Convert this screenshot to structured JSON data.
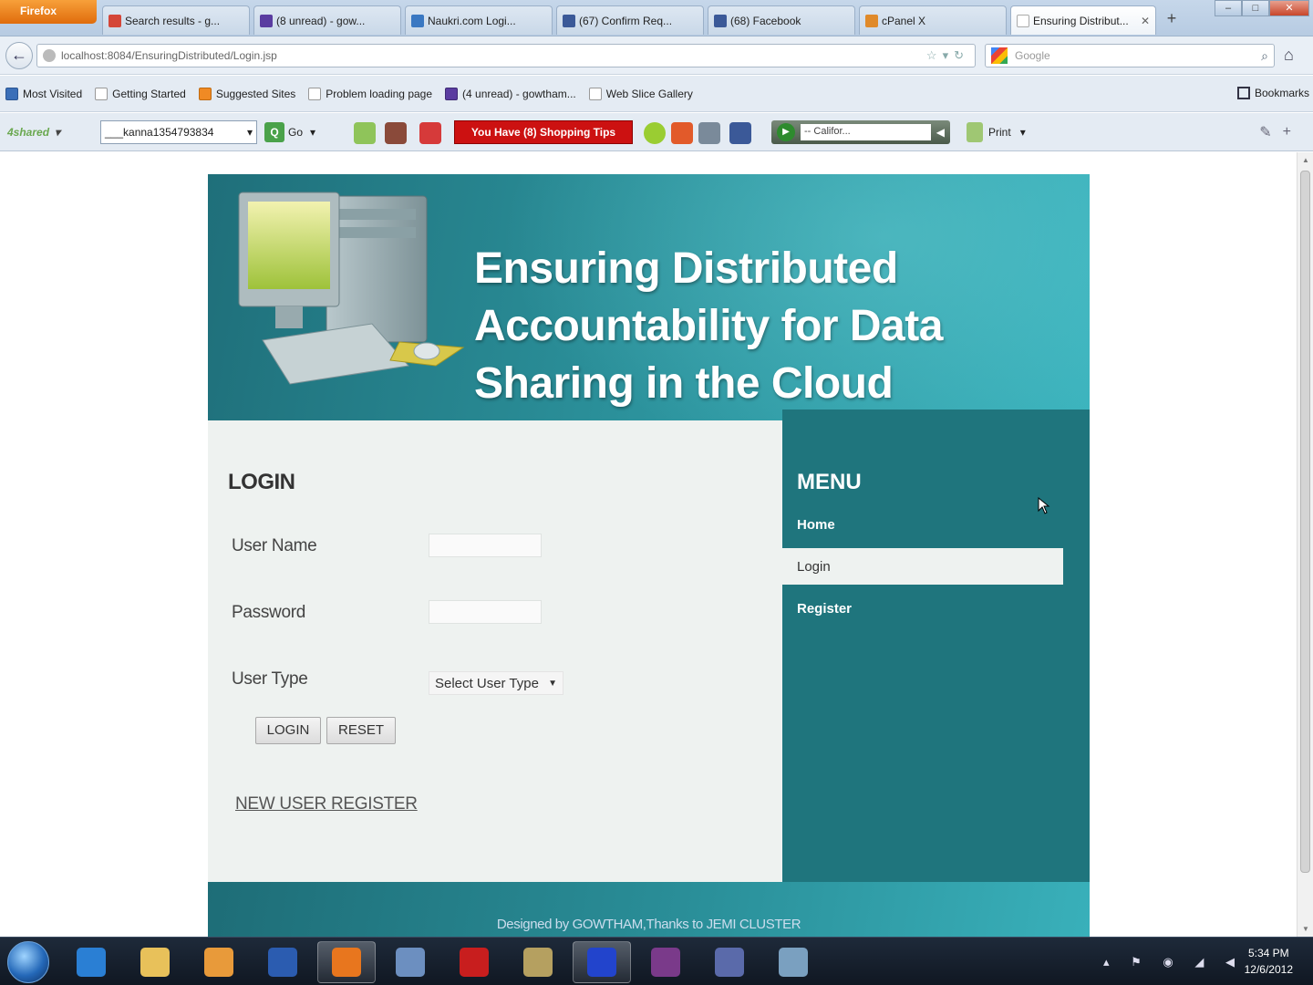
{
  "browser": {
    "menu_button": "Firefox",
    "tabs": [
      {
        "label": "Search results - g...",
        "color": "#d44638"
      },
      {
        "label": "(8 unread) - gow...",
        "color": "#5a3ca0"
      },
      {
        "label": "Naukri.com Logi...",
        "color": "#3a78c2"
      },
      {
        "label": "(67) Confirm Req...",
        "color": "#3b5998"
      },
      {
        "label": "(68) Facebook",
        "color": "#3b5998"
      },
      {
        "label": "cPanel X",
        "color": "#e08a2a"
      },
      {
        "label": "Ensuring Distribut...",
        "color": "#ffffff"
      }
    ],
    "new_tab": "+",
    "window_controls": {
      "minimize": "–",
      "maximize": "□",
      "close": "✕"
    },
    "url": "localhost:8084/EnsuringDistributed/Login.jsp",
    "search_placeholder": "Google",
    "bookmarks": [
      {
        "label": "Most Visited",
        "icon": "blue"
      },
      {
        "label": "Getting Started",
        "icon": ""
      },
      {
        "label": "Suggested Sites",
        "icon": "orange"
      },
      {
        "label": "Problem loading page",
        "icon": ""
      },
      {
        "label": "(4 unread) - gowtham...",
        "icon": "purple"
      },
      {
        "label": "Web Slice Gallery",
        "icon": ""
      }
    ],
    "bookmarks_menu": "Bookmarks",
    "toolbar": {
      "logo": "4shared",
      "field_value": "___kanna1354793834",
      "go_label": "Go",
      "shopping_label": "You Have (8) Shopping Tips",
      "player_field": "-- Califor...",
      "print_label": "Print"
    }
  },
  "site": {
    "title": "Ensuring Distributed Accountability for Data Sharing in the Cloud",
    "login": {
      "heading": "LOGIN",
      "username_label": "User Name",
      "password_label": "Password",
      "usertype_label": "User Type",
      "usertype_value": "Select User Type",
      "login_button": "LOGIN",
      "reset_button": "RESET",
      "register_link": "NEW USER REGISTER"
    },
    "menu": {
      "heading": "MENU",
      "items": [
        {
          "label": "Home"
        },
        {
          "label": "Login"
        },
        {
          "label": "Register"
        }
      ]
    },
    "footer": "Designed by GOWTHAM,Thanks to JEMI CLUSTER"
  },
  "taskbar": {
    "apps": [
      {
        "name": "internet-explorer",
        "color": "#2a7fd4"
      },
      {
        "name": "file-explorer",
        "color": "#e8c15a"
      },
      {
        "name": "media-player",
        "color": "#e89a3a"
      },
      {
        "name": "word",
        "color": "#2b5cb0"
      },
      {
        "name": "firefox",
        "color": "#e8761e"
      },
      {
        "name": "virtualbox",
        "color": "#6c8fc0"
      },
      {
        "name": "acrobat",
        "color": "#c81e1e"
      },
      {
        "name": "tools",
        "color": "#b5a060"
      },
      {
        "name": "app-blue",
        "color": "#2244cc"
      },
      {
        "name": "winrar",
        "color": "#7a3a8a"
      },
      {
        "name": "eclipse",
        "color": "#5a6aaa"
      },
      {
        "name": "notes",
        "color": "#7aa0c0"
      }
    ],
    "time": "5:34 PM",
    "date": "12/6/2012"
  }
}
